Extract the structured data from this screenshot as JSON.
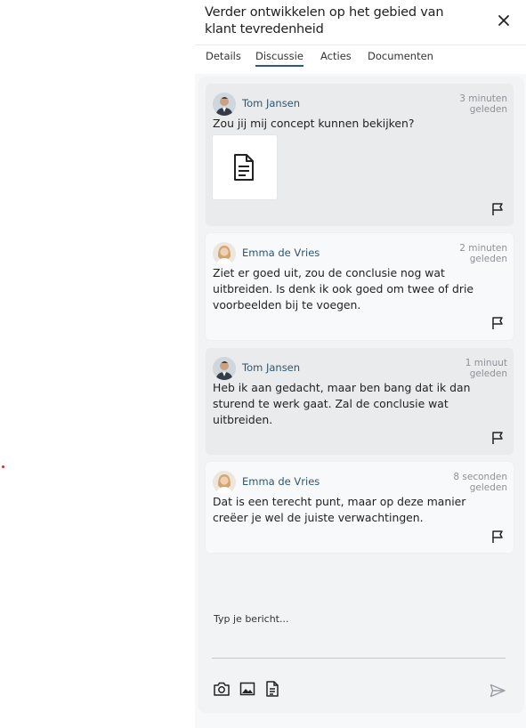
{
  "panel": {
    "title": "Verder ontwikkelen op het gebied van klant tevredenheid",
    "close_icon": "close-icon"
  },
  "tabs": [
    {
      "label": "Details",
      "active": false
    },
    {
      "label": "Discussie",
      "active": true
    },
    {
      "label": "Acties",
      "active": false
    },
    {
      "label": "Documenten",
      "active": false
    }
  ],
  "messages": [
    {
      "author": "Tom Jansen",
      "time": [
        "3 minuten",
        "geleden"
      ],
      "text": [
        "Zou jij mij concept kunnen bekijken?"
      ],
      "attachment": "document-icon",
      "variant": "outgoing"
    },
    {
      "author": "Emma de Vries",
      "time": [
        "2 minuten",
        "geleden"
      ],
      "text": [
        "Ziet er goed uit, zou de conclusie nog wat",
        "uitbreiden. Is denk ik ook goed om twee of drie",
        "voorbeelden bij te voegen."
      ],
      "variant": "incoming"
    },
    {
      "author": "Tom Jansen",
      "time": [
        "1 minuut",
        "geleden"
      ],
      "text": [
        "Heb ik aan gedacht, maar ben bang dat ik dan",
        "sturend te werk gaat. Zal de conclusie wat",
        "uitbreiden."
      ],
      "variant": "outgoing"
    },
    {
      "author": "Emma de Vries",
      "time": [
        "8 seconden",
        "geleden"
      ],
      "text": [
        "Dat is een terecht punt, maar op deze manier",
        "creëer je wel de juiste verwachtingen."
      ],
      "variant": "incoming"
    }
  ],
  "composer": {
    "placeholder": "Typ je bericht...",
    "tools": [
      "camera-icon",
      "image-icon",
      "document-icon"
    ],
    "send_icon": "send-icon"
  },
  "colors": {
    "accent": "#2c5a78",
    "marker": "#e0262b"
  }
}
